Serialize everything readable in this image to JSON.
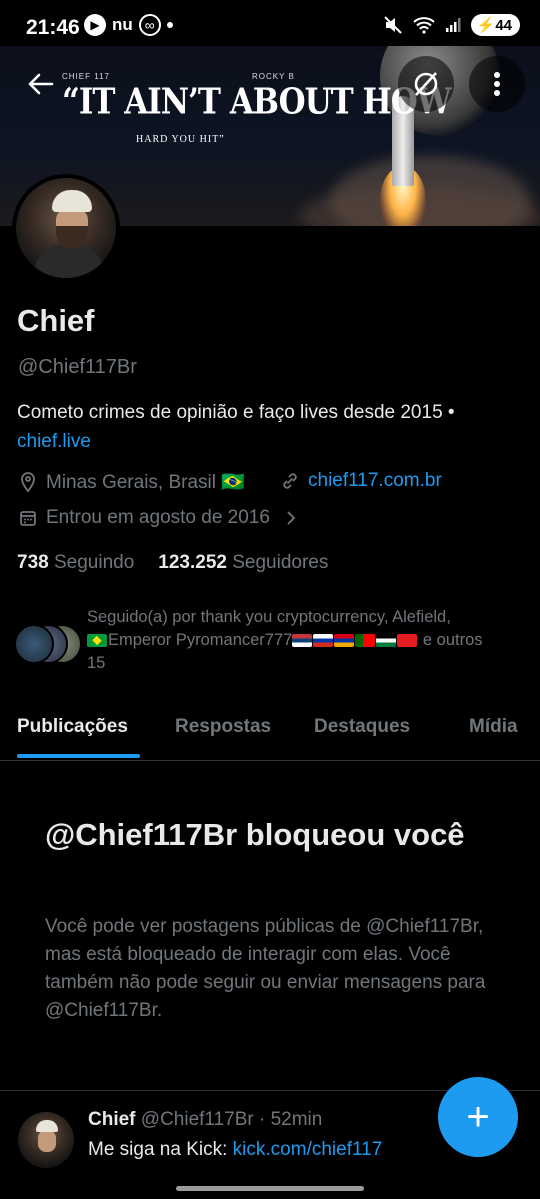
{
  "status_bar": {
    "time": "21:46",
    "nu": "nu",
    "battery": "44"
  },
  "banner": {
    "small_left": "CHIEF 117",
    "small_right": "ROCKY B",
    "headline": "“IT AIN’T ABOUT HOW",
    "sub": "HARD YOU HIT”"
  },
  "profile": {
    "name": "Chief",
    "handle": "@Chief117Br",
    "bio": "Cometo crimes de opinião e faço lives desde 2015 •",
    "bio_link": "chief.live",
    "location": "Minas Gerais, Brasil 🇧🇷",
    "website": "chief117.com.br",
    "joined": "Entrou em agosto de 2016",
    "following_count": "738",
    "following_label": "Seguindo",
    "followers_count": "123.252",
    "followers_label": "Seguidores",
    "followed_by_1": "Seguido(a) por thank you cryptocurrency, Alefield,",
    "followed_by_2": "Emperor Pyromancer777",
    "followed_by_3": "e outros",
    "followed_by_4": "15"
  },
  "tabs": [
    "Publicações",
    "Respostas",
    "Destaques",
    "Mídia"
  ],
  "blocked": {
    "title": "@Chief117Br bloqueou você",
    "body": "Você pode ver postagens públicas de @Chief117Br, mas está bloqueado de interagir com elas. Você também não pode seguir ou enviar mensagens para @Chief117Br."
  },
  "tweet": {
    "name": "Chief",
    "handle_time": "@Chief117Br · 52min",
    "text": "Me siga na Kick: ",
    "link": "kick.com/chief117"
  },
  "fab_label": "+",
  "colors": {
    "accent": "#1d9bf0",
    "background": "#000000",
    "muted": "#71767b"
  }
}
